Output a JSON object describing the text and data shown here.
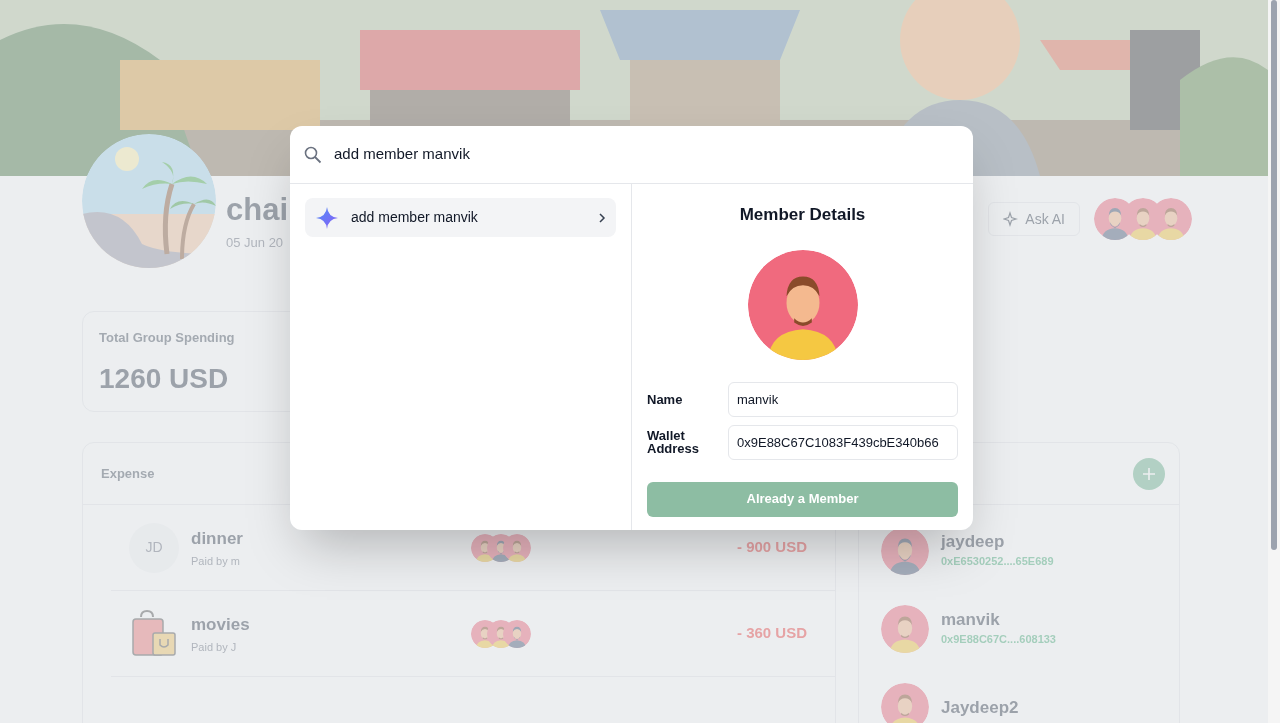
{
  "group": {
    "name": "chai",
    "date": "05 Jun 20"
  },
  "ask_ai_button": {
    "label": "Ask AI"
  },
  "header_members": [
    {
      "kind": "bearded"
    },
    {
      "kind": "hoodie"
    },
    {
      "kind": "hoodie"
    }
  ],
  "total_spending": {
    "label": "Total Group Spending",
    "amount": "1260 USD"
  },
  "expenses": {
    "heading": "Expense",
    "rows": [
      {
        "kind": "initials",
        "initials": "JD",
        "title": "dinner",
        "paid_by": "Paid by m",
        "participants": [
          {
            "kind": "hoodie"
          },
          {
            "kind": "bearded"
          },
          {
            "kind": "hoodie"
          }
        ],
        "amount": "- 900 USD"
      },
      {
        "kind": "bag",
        "title": "movies",
        "paid_by": "Paid by J",
        "participants": [
          {
            "kind": "hoodie"
          },
          {
            "kind": "hoodie"
          },
          {
            "kind": "bearded"
          }
        ],
        "amount": "- 360 USD"
      }
    ]
  },
  "members": [
    {
      "name": "jaydeep",
      "address": "0xE6530252....65E689",
      "kind": "bearded"
    },
    {
      "name": "manvik",
      "address": "0x9E88C67C....608133",
      "kind": "hoodie"
    },
    {
      "name": "Jaydeep2",
      "kind": "hoodie"
    }
  ],
  "command_palette": {
    "query": "add member manvik",
    "results": [
      {
        "label": "add member manvik",
        "selected": true
      }
    ],
    "details": {
      "title": "Member Details",
      "kind": "hoodie",
      "fields": [
        {
          "label": "Name",
          "value": "manvik"
        },
        {
          "label": "Wallet Address",
          "value": "0x9E88C67C1083F439cbE340b66"
        }
      ],
      "action": {
        "label": "Already a Member",
        "disabled": true
      }
    }
  }
}
